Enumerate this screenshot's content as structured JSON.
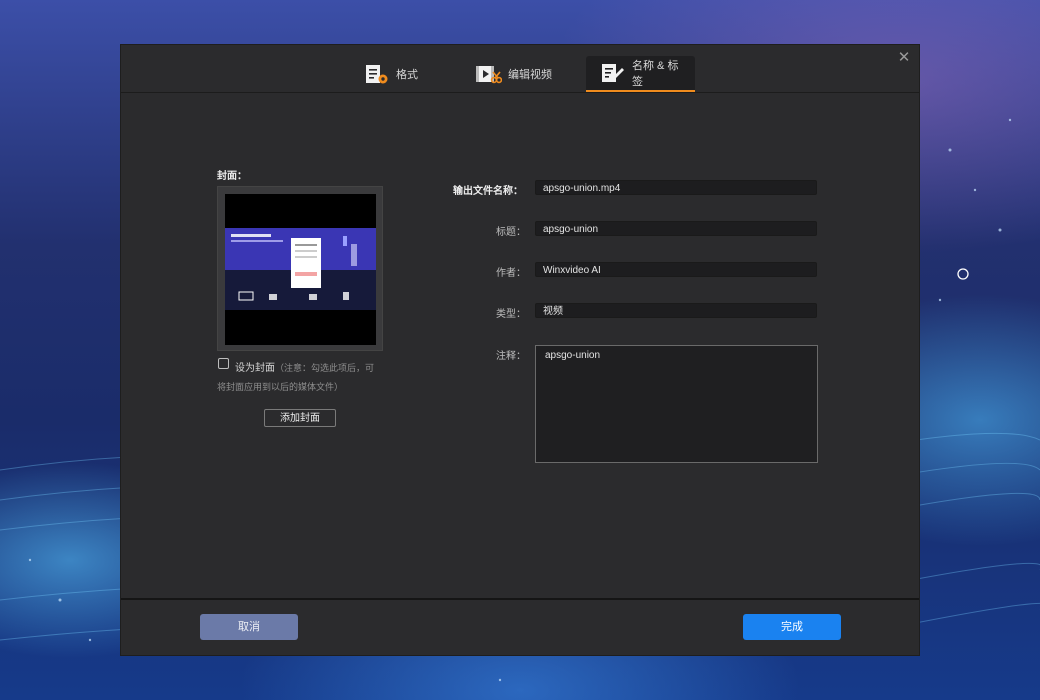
{
  "dialog": {
    "tabs": [
      {
        "label": "格式",
        "icon": "format-settings-icon"
      },
      {
        "label": "编辑视频",
        "icon": "edit-video-icon"
      },
      {
        "label": "名称 & 标签",
        "icon": "name-tag-icon"
      }
    ],
    "active_tab": "名称 & 标签",
    "close_icon": "close-icon"
  },
  "cover": {
    "title": "封面：",
    "checkbox_label": "设为封面",
    "checkbox_checked": false,
    "note_part1": "（注意：勾选此项后，可",
    "note_part2": "将封面应用到以后的媒体文件）",
    "add_button": "添加封面",
    "thumbnail": {
      "banner_headline": "装了就能一起了吧，五分一键就搞",
      "panel_button": "登录",
      "caption": "设置"
    }
  },
  "fields": {
    "output_name_label": "输出文件名称：",
    "output_name_value": "apsgo-union.mp4",
    "title_label": "标题：",
    "title_value": "apsgo-union",
    "author_label": "作者：",
    "author_value": "Winxvideo AI",
    "genre_label": "类型：",
    "genre_value": "视频",
    "comment_label": "注释：",
    "comment_value": "apsgo-union"
  },
  "footer": {
    "cancel_label": "取消",
    "done_label": "完成"
  },
  "colors": {
    "accent_tab": "#f08c1e",
    "done_button": "#1a82f0",
    "cancel_button": "#6b7aa8",
    "dialog_bg": "#2b2b2d"
  }
}
